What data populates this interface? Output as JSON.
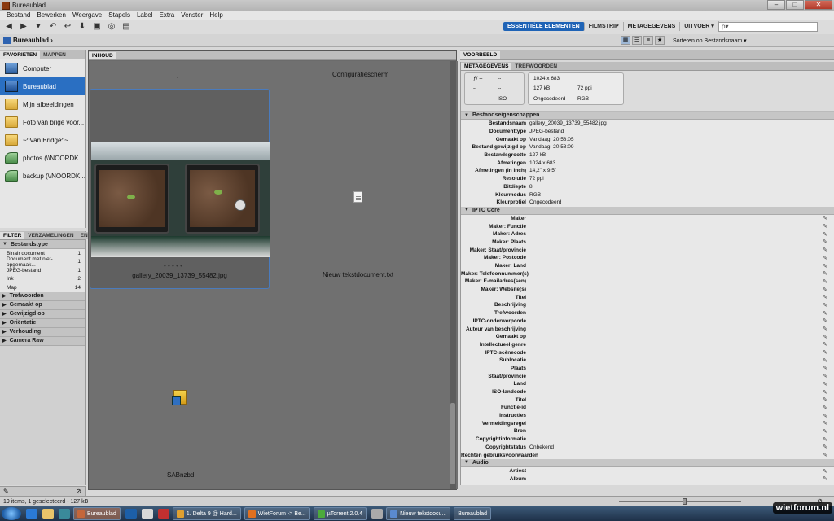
{
  "window": {
    "title": "Bureaublad",
    "buttons": [
      "–",
      "□",
      "✕"
    ]
  },
  "menu": [
    "Bestand",
    "Bewerken",
    "Weergave",
    "Stapels",
    "Label",
    "Extra",
    "Venster",
    "Help"
  ],
  "workspaces": [
    "ESSENTIËLE ELEMENTEN",
    "FILMSTRIP",
    "METAGEGEVENS",
    "UITVOER ▾"
  ],
  "search": {
    "placeholder": "ρ▾"
  },
  "path": {
    "crumb": "Bureaublad",
    "sort_label": "Sorteren op Bestandsnaam ▾"
  },
  "left_tabs": [
    "FAVORIETEN",
    "MAPPEN"
  ],
  "favorites": [
    {
      "label": "Computer",
      "icon": "computer-icon"
    },
    {
      "label": "Bureaublad",
      "icon": "desktop-icon"
    },
    {
      "label": "Mijn afbeeldingen",
      "icon": "folder-icon"
    },
    {
      "label": "Foto van brige voor...",
      "icon": "folder-icon"
    },
    {
      "label": "~^Van Bridge^~",
      "icon": "folder-icon"
    },
    {
      "label": "photos (\\\\NOORDK...",
      "icon": "network-drive-icon"
    },
    {
      "label": "backup (\\\\NOORDK...",
      "icon": "network-drive-icon"
    }
  ],
  "filter_tabs": [
    "FILTER",
    "VERZAMELINGEN",
    "EN"
  ],
  "filter": {
    "group_open": "Bestandstype",
    "rows": [
      {
        "label": "Binair document",
        "count": "1"
      },
      {
        "label": "Document met niet-opgemaak...",
        "count": "1"
      },
      {
        "label": "JPEG-bestand",
        "count": "1"
      },
      {
        "label": "Ink",
        "count": "2"
      },
      {
        "label": "Map",
        "count": "14"
      }
    ],
    "groups": [
      "Trefwoorden",
      "Gemaakt op",
      "Gewijzigd op",
      "Oriëntatie",
      "Verhouding",
      "Camera Raw"
    ]
  },
  "content": {
    "tab": "INHOUD",
    "items": [
      {
        "label": "gallery_20039_13739_55482.jpg",
        "dots": "• • • • •"
      },
      {
        "label": "Configuratiescherm"
      },
      {
        "label": "Nieuw tekstdocument.txt"
      },
      {
        "label": "SABnzbd"
      }
    ],
    "top_left_mark": "."
  },
  "right": {
    "preview_tab": "VOORBEELD",
    "meta_tabs": [
      "METAGEGEVENS",
      "TREFWOORDEN"
    ],
    "summary": {
      "aperture": "ƒ/ --",
      "shutter": "--",
      "ev": "--",
      "ev2": "--",
      "wb": "--",
      "iso": "ISO --",
      "dims": "1024 x 683",
      "size": "127 kB",
      "ppi": "72 ppi",
      "mode": "Ongecodeerd",
      "color": "RGB"
    },
    "file_section": "Bestandseigenschappen",
    "file_props": [
      {
        "k": "Bestandsnaam",
        "v": "gallery_20039_13739_55482.jpg"
      },
      {
        "k": "Documenttype",
        "v": "JPEG-bestand"
      },
      {
        "k": "Gemaakt op",
        "v": "Vandaag, 20:58:05"
      },
      {
        "k": "Bestand gewijzigd op",
        "v": "Vandaag, 20:58:09"
      },
      {
        "k": "Bestandsgrootte",
        "v": "127 kB"
      },
      {
        "k": "Afmetingen",
        "v": "1024 x 683"
      },
      {
        "k": "Afmetingen (in inch)",
        "v": "14,2\" x 9,5\""
      },
      {
        "k": "Resolutie",
        "v": "72 ppi"
      },
      {
        "k": "Bitdiepte",
        "v": "8"
      },
      {
        "k": "Kleurmodus",
        "v": "RGB"
      },
      {
        "k": "Kleurprofiel",
        "v": "Ongecodeerd"
      }
    ],
    "iptc_section": "IPTC Core",
    "iptc_fields": [
      {
        "k": "Maker",
        "v": ""
      },
      {
        "k": "Maker: Functie",
        "v": ""
      },
      {
        "k": "Maker: Adres",
        "v": ""
      },
      {
        "k": "Maker: Plaats",
        "v": ""
      },
      {
        "k": "Maker: Staat/provincie",
        "v": ""
      },
      {
        "k": "Maker: Postcode",
        "v": ""
      },
      {
        "k": "Maker: Land",
        "v": ""
      },
      {
        "k": "Maker: Telefoonnummer(s)",
        "v": ""
      },
      {
        "k": "Maker: E-mailadres(sen)",
        "v": ""
      },
      {
        "k": "Maker: Website(s)",
        "v": ""
      },
      {
        "k": "Titel",
        "v": ""
      },
      {
        "k": "Beschrijving",
        "v": ""
      },
      {
        "k": "Trefwoorden",
        "v": ""
      },
      {
        "k": "IPTC-onderwerpcode",
        "v": ""
      },
      {
        "k": "Auteur van beschrijving",
        "v": ""
      },
      {
        "k": "Gemaakt op",
        "v": ""
      },
      {
        "k": "Intellectueel genre",
        "v": ""
      },
      {
        "k": "IPTC-scènecode",
        "v": ""
      },
      {
        "k": "Sublocatie",
        "v": ""
      },
      {
        "k": "Plaats",
        "v": ""
      },
      {
        "k": "Staat/provincie",
        "v": ""
      },
      {
        "k": "Land",
        "v": ""
      },
      {
        "k": "ISO-landcode",
        "v": ""
      },
      {
        "k": "Titel",
        "v": ""
      },
      {
        "k": "Functie-id",
        "v": ""
      },
      {
        "k": "Instructies",
        "v": ""
      },
      {
        "k": "Vermeldingsregel",
        "v": ""
      },
      {
        "k": "Bron",
        "v": ""
      },
      {
        "k": "Copyrightinformatie",
        "v": ""
      },
      {
        "k": "Copyrightstatus",
        "v": "Onbekend"
      },
      {
        "k": "Rechten gebruiksvoorwaarden",
        "v": ""
      }
    ],
    "audio_section": "Audio",
    "audio_fields": [
      {
        "k": "Artiest",
        "v": ""
      },
      {
        "k": "Album",
        "v": ""
      }
    ]
  },
  "status": {
    "text": "19 items, 1 geselecteerd - 127 kB"
  },
  "taskbar": {
    "tasks": [
      {
        "label": "Bureaublad",
        "active": true,
        "color": "#c4663a"
      },
      {
        "label": "1. Delta 9 @ Hard...",
        "active": false,
        "color": "#e0a030"
      },
      {
        "label": "WietForum -> Be...",
        "active": false,
        "color": "#e07020"
      },
      {
        "label": "µTorrent 2.0.4",
        "active": false,
        "color": "#4caa3c"
      },
      {
        "label": "Nieuw tekstdocu...",
        "active": false,
        "color": "#5a8ad0"
      },
      {
        "label": "Bureaublad",
        "active": false,
        "color": "#c4663a"
      }
    ],
    "watermark": "wietforum.nl"
  },
  "colors": {
    "accent": "#1e63b6",
    "selection": "#2a6fc2",
    "content_bg": "#707070"
  }
}
